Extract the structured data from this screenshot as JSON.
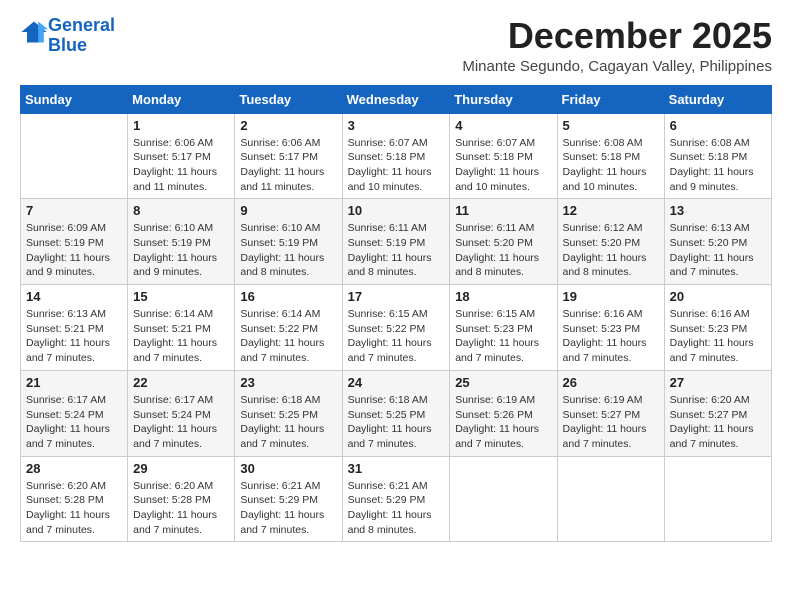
{
  "header": {
    "logo_line1": "General",
    "logo_line2": "Blue",
    "title": "December 2025",
    "subtitle": "Minante Segundo, Cagayan Valley, Philippines"
  },
  "columns": [
    "Sunday",
    "Monday",
    "Tuesday",
    "Wednesday",
    "Thursday",
    "Friday",
    "Saturday"
  ],
  "weeks": [
    [
      {
        "day": "",
        "sunrise": "",
        "sunset": "",
        "daylight": ""
      },
      {
        "day": "1",
        "sunrise": "6:06 AM",
        "sunset": "5:17 PM",
        "daylight": "11 hours and 11 minutes."
      },
      {
        "day": "2",
        "sunrise": "6:06 AM",
        "sunset": "5:17 PM",
        "daylight": "11 hours and 11 minutes."
      },
      {
        "day": "3",
        "sunrise": "6:07 AM",
        "sunset": "5:18 PM",
        "daylight": "11 hours and 10 minutes."
      },
      {
        "day": "4",
        "sunrise": "6:07 AM",
        "sunset": "5:18 PM",
        "daylight": "11 hours and 10 minutes."
      },
      {
        "day": "5",
        "sunrise": "6:08 AM",
        "sunset": "5:18 PM",
        "daylight": "11 hours and 10 minutes."
      },
      {
        "day": "6",
        "sunrise": "6:08 AM",
        "sunset": "5:18 PM",
        "daylight": "11 hours and 9 minutes."
      }
    ],
    [
      {
        "day": "7",
        "sunrise": "6:09 AM",
        "sunset": "5:19 PM",
        "daylight": "11 hours and 9 minutes."
      },
      {
        "day": "8",
        "sunrise": "6:10 AM",
        "sunset": "5:19 PM",
        "daylight": "11 hours and 9 minutes."
      },
      {
        "day": "9",
        "sunrise": "6:10 AM",
        "sunset": "5:19 PM",
        "daylight": "11 hours and 8 minutes."
      },
      {
        "day": "10",
        "sunrise": "6:11 AM",
        "sunset": "5:19 PM",
        "daylight": "11 hours and 8 minutes."
      },
      {
        "day": "11",
        "sunrise": "6:11 AM",
        "sunset": "5:20 PM",
        "daylight": "11 hours and 8 minutes."
      },
      {
        "day": "12",
        "sunrise": "6:12 AM",
        "sunset": "5:20 PM",
        "daylight": "11 hours and 8 minutes."
      },
      {
        "day": "13",
        "sunrise": "6:13 AM",
        "sunset": "5:20 PM",
        "daylight": "11 hours and 7 minutes."
      }
    ],
    [
      {
        "day": "14",
        "sunrise": "6:13 AM",
        "sunset": "5:21 PM",
        "daylight": "11 hours and 7 minutes."
      },
      {
        "day": "15",
        "sunrise": "6:14 AM",
        "sunset": "5:21 PM",
        "daylight": "11 hours and 7 minutes."
      },
      {
        "day": "16",
        "sunrise": "6:14 AM",
        "sunset": "5:22 PM",
        "daylight": "11 hours and 7 minutes."
      },
      {
        "day": "17",
        "sunrise": "6:15 AM",
        "sunset": "5:22 PM",
        "daylight": "11 hours and 7 minutes."
      },
      {
        "day": "18",
        "sunrise": "6:15 AM",
        "sunset": "5:23 PM",
        "daylight": "11 hours and 7 minutes."
      },
      {
        "day": "19",
        "sunrise": "6:16 AM",
        "sunset": "5:23 PM",
        "daylight": "11 hours and 7 minutes."
      },
      {
        "day": "20",
        "sunrise": "6:16 AM",
        "sunset": "5:23 PM",
        "daylight": "11 hours and 7 minutes."
      }
    ],
    [
      {
        "day": "21",
        "sunrise": "6:17 AM",
        "sunset": "5:24 PM",
        "daylight": "11 hours and 7 minutes."
      },
      {
        "day": "22",
        "sunrise": "6:17 AM",
        "sunset": "5:24 PM",
        "daylight": "11 hours and 7 minutes."
      },
      {
        "day": "23",
        "sunrise": "6:18 AM",
        "sunset": "5:25 PM",
        "daylight": "11 hours and 7 minutes."
      },
      {
        "day": "24",
        "sunrise": "6:18 AM",
        "sunset": "5:25 PM",
        "daylight": "11 hours and 7 minutes."
      },
      {
        "day": "25",
        "sunrise": "6:19 AM",
        "sunset": "5:26 PM",
        "daylight": "11 hours and 7 minutes."
      },
      {
        "day": "26",
        "sunrise": "6:19 AM",
        "sunset": "5:27 PM",
        "daylight": "11 hours and 7 minutes."
      },
      {
        "day": "27",
        "sunrise": "6:20 AM",
        "sunset": "5:27 PM",
        "daylight": "11 hours and 7 minutes."
      }
    ],
    [
      {
        "day": "28",
        "sunrise": "6:20 AM",
        "sunset": "5:28 PM",
        "daylight": "11 hours and 7 minutes."
      },
      {
        "day": "29",
        "sunrise": "6:20 AM",
        "sunset": "5:28 PM",
        "daylight": "11 hours and 7 minutes."
      },
      {
        "day": "30",
        "sunrise": "6:21 AM",
        "sunset": "5:29 PM",
        "daylight": "11 hours and 7 minutes."
      },
      {
        "day": "31",
        "sunrise": "6:21 AM",
        "sunset": "5:29 PM",
        "daylight": "11 hours and 8 minutes."
      },
      {
        "day": "",
        "sunrise": "",
        "sunset": "",
        "daylight": ""
      },
      {
        "day": "",
        "sunrise": "",
        "sunset": "",
        "daylight": ""
      },
      {
        "day": "",
        "sunrise": "",
        "sunset": "",
        "daylight": ""
      }
    ]
  ],
  "labels": {
    "sunrise_prefix": "Sunrise: ",
    "sunset_prefix": "Sunset: ",
    "daylight_prefix": "Daylight: "
  }
}
